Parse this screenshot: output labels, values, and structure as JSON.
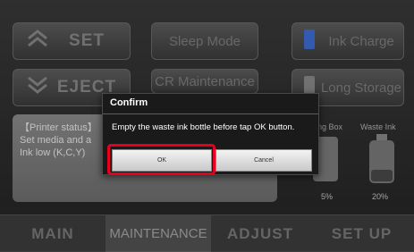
{
  "top_buttons": {
    "set_label": "SET",
    "eject_label": "EJECT",
    "sleep_mode_label": "Sleep Mode",
    "cr_maintenance_label": "CR Maintenance",
    "ink_charge_label": "Ink Charge",
    "long_storage_label": "Long Storage"
  },
  "status": {
    "line1": "【Printer status】",
    "line2": "Set media and a",
    "line3": "Ink low (K,C,Y)"
  },
  "ink": {
    "flushing_box_label": "ng Box",
    "waste_ink_label": "Waste Ink",
    "flushing_box_pct": "5%",
    "waste_ink_pct": "20%"
  },
  "tabs": [
    {
      "label": "MAIN"
    },
    {
      "label": "MAINTENANCE"
    },
    {
      "label": "ADJUST"
    },
    {
      "label": "SET UP"
    }
  ],
  "active_tab": "MAINTENANCE",
  "dialog": {
    "title": "Confirm",
    "message": "Empty the waste ink bottle before tap OK button.",
    "ok_label": "OK",
    "cancel_label": "Cancel"
  },
  "colors": {
    "highlight": "#e4001e",
    "ink_cartridge_icon": "#3d6fd6"
  },
  "icons": [
    "chevron-double-up-icon",
    "chevron-double-down-icon",
    "ink-cartridge-icon",
    "storage-box-icon"
  ]
}
